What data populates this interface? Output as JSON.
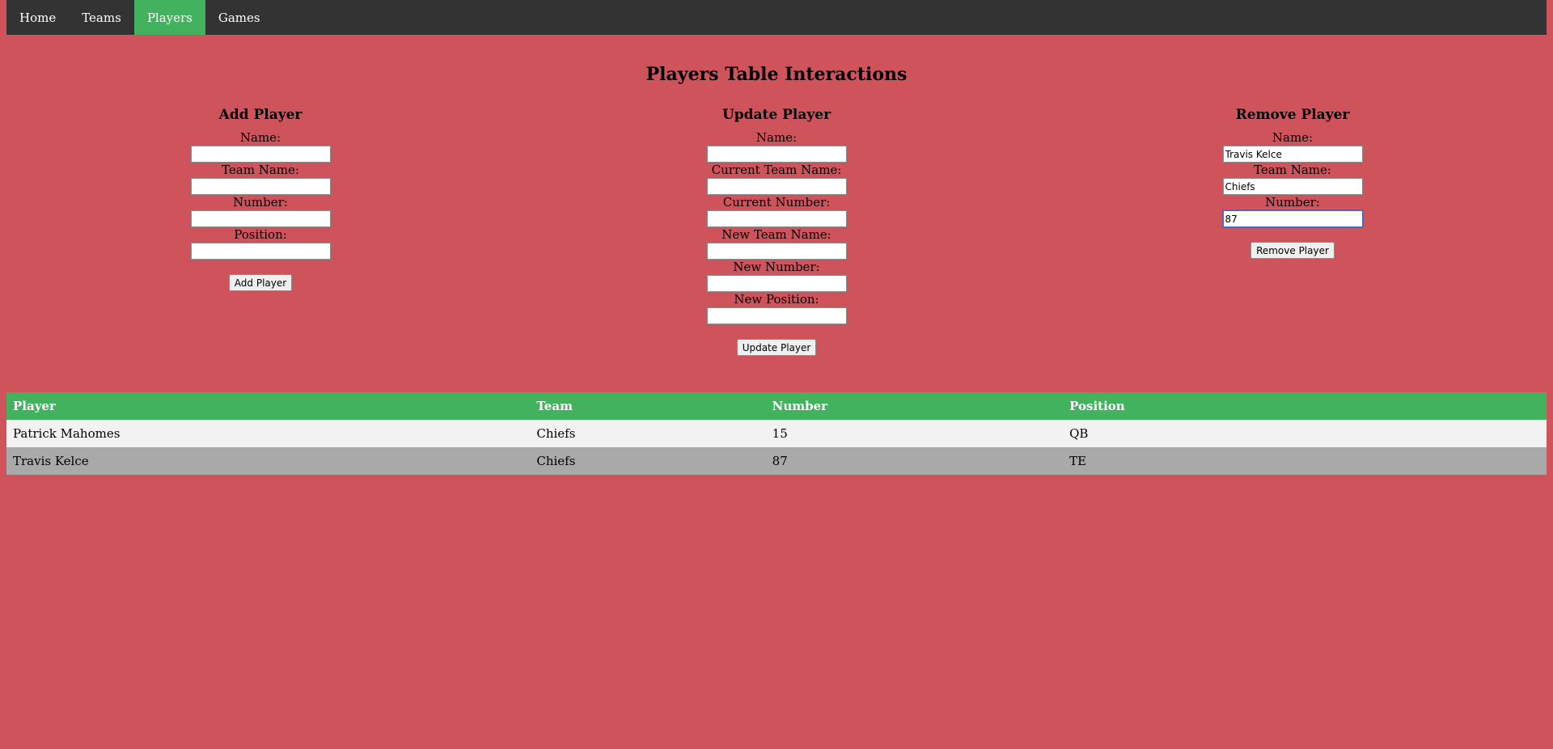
{
  "nav": {
    "items": [
      {
        "label": "Home",
        "active": false
      },
      {
        "label": "Teams",
        "active": false
      },
      {
        "label": "Players",
        "active": true
      },
      {
        "label": "Games",
        "active": false
      }
    ]
  },
  "page_title": "Players Table Interactions",
  "add_form": {
    "title": "Add Player",
    "fields": [
      {
        "label": "Name:",
        "value": ""
      },
      {
        "label": "Team Name:",
        "value": ""
      },
      {
        "label": "Number:",
        "value": ""
      },
      {
        "label": "Position:",
        "value": ""
      }
    ],
    "button": "Add Player"
  },
  "update_form": {
    "title": "Update Player",
    "fields": [
      {
        "label": "Name:",
        "value": ""
      },
      {
        "label": "Current Team Name:",
        "value": ""
      },
      {
        "label": "Current Number:",
        "value": ""
      },
      {
        "label": "New Team Name:",
        "value": ""
      },
      {
        "label": "New Number:",
        "value": ""
      },
      {
        "label": "New Position:",
        "value": ""
      }
    ],
    "button": "Update Player"
  },
  "remove_form": {
    "title": "Remove Player",
    "fields": [
      {
        "label": "Name:",
        "value": "Travis Kelce"
      },
      {
        "label": "Team Name:",
        "value": "Chiefs"
      },
      {
        "label": "Number:",
        "value": "87"
      }
    ],
    "button": "Remove Player"
  },
  "table": {
    "headers": [
      "Player",
      "Team",
      "Number",
      "Position"
    ],
    "rows": [
      [
        "Patrick Mahomes",
        "Chiefs",
        "15",
        "QB"
      ],
      [
        "Travis Kelce",
        "Chiefs",
        "87",
        "TE"
      ]
    ]
  },
  "colors": {
    "background": "#cf535a",
    "nav_background": "#333333",
    "accent_green": "#43b25f",
    "row_light": "#f2f2f2",
    "row_dark": "#a9a9a9"
  }
}
